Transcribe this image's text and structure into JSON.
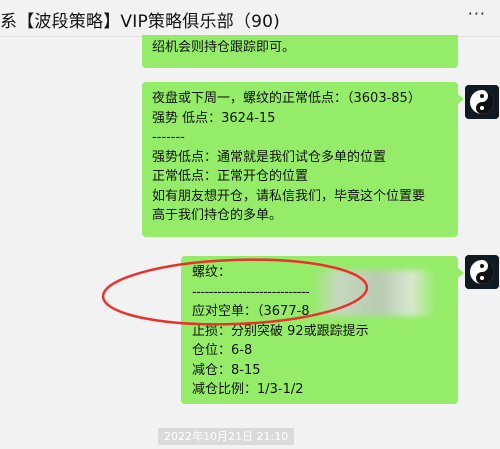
{
  "header": {
    "title": "系【波段策略】VIP策略俱乐部（90)",
    "more_glyph": "···"
  },
  "messages": [
    {
      "lines": [
        "绍机会则持仓跟踪即可。"
      ]
    },
    {
      "lines": [
        "夜盘或下周一，螺纹的正常低点：（3603-85）",
        "强势 低点：3624-15",
        "-------",
        "强势低点：通常就是我们试仓多单的位置",
        "正常低点：正常开仓的位置",
        "如有朋友想开仓，请私信我们，毕竟这个位置要",
        "高于我们持仓的多单。"
      ]
    },
    {
      "lines": [
        "螺纹：",
        "----------------------------",
        "应对空单：（3677-8",
        "止损：分别突破 92或跟踪提示",
        "仓位：6-8",
        "减仓：8-15",
        "减仓比例：1/3-1/2"
      ]
    }
  ],
  "timestamp": "2022年10月21日 21:10",
  "colors": {
    "bubble": "#95ec69",
    "annotation": "#e8322d",
    "background": "#f2f2f2"
  }
}
